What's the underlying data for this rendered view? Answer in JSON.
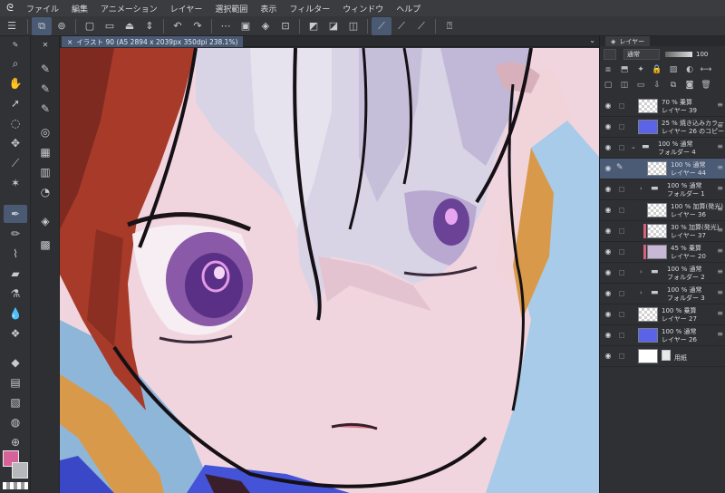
{
  "menu": [
    "ファイル",
    "編集",
    "アニメーション",
    "レイヤー",
    "選択範囲",
    "表示",
    "フィルター",
    "ウィンドウ",
    "ヘルプ"
  ],
  "document_tab": {
    "close": "×",
    "title": "イラスト 90 (A5 2894 x 2039px 350dpi 238.1%)"
  },
  "layer_panel": {
    "tab_label": "レイヤー",
    "blend_mode": "通常",
    "opacity": "100",
    "layers": [
      {
        "l1": "70 % 乗算",
        "l2": "レイヤー 39",
        "thumb": "check",
        "indent": 0
      },
      {
        "l1": "25 % 焼き込みカラー",
        "l2": "レイヤー 26 のコピー",
        "thumb": "#5b63e8",
        "indent": 0
      },
      {
        "l1": "100 % 通常",
        "l2": "フォルダー 4",
        "thumb": "folder-open",
        "indent": 0
      },
      {
        "l1": "100 % 通常",
        "l2": "レイヤー 44",
        "thumb": "check",
        "indent": 1,
        "selected": true
      },
      {
        "l1": "100 % 通常",
        "l2": "フォルダー 1",
        "thumb": "folder",
        "indent": 1
      },
      {
        "l1": "100 % 加算(発光)",
        "l2": "レイヤー 36",
        "thumb": "check",
        "indent": 1
      },
      {
        "l1": "30 % 加算(発光)",
        "l2": "レイヤー 37",
        "thumb": "check",
        "indent": 1,
        "clip": true
      },
      {
        "l1": "45 % 乗算",
        "l2": "レイヤー 20",
        "thumb": "#c9b7d6",
        "indent": 1,
        "clip": true
      },
      {
        "l1": "100 % 通常",
        "l2": "フォルダー 2",
        "thumb": "folder",
        "indent": 1
      },
      {
        "l1": "100 % 通常",
        "l2": "フォルダー 3",
        "thumb": "folder",
        "indent": 1
      },
      {
        "l1": "100 % 乗算",
        "l2": "レイヤー 27",
        "thumb": "check",
        "indent": 0
      },
      {
        "l1": "100 % 通常",
        "l2": "レイヤー 26",
        "thumb": "#5b63e8",
        "indent": 0
      },
      {
        "l1": "",
        "l2": "用紙",
        "thumb": "#ffffff",
        "indent": 0,
        "paper": true
      }
    ]
  },
  "colors": {
    "main": "#d6629a",
    "sub": "#b7b8ba",
    "accent": "#4b5a73"
  }
}
